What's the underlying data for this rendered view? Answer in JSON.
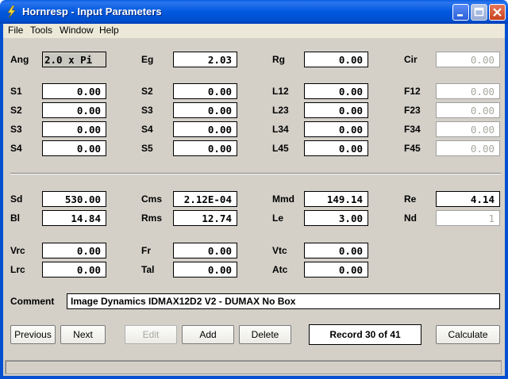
{
  "window": {
    "title": "Hornresp - Input Parameters"
  },
  "menu": [
    "File",
    "Tools",
    "Window",
    "Help"
  ],
  "fields_top": {
    "Ang": {
      "label": "Ang",
      "value": "2.0 x Pi"
    },
    "Eg": {
      "label": "Eg",
      "value": "2.03"
    },
    "Rg": {
      "label": "Rg",
      "value": "0.00"
    },
    "Cir": {
      "label": "Cir",
      "value": "0.00"
    },
    "S1a": {
      "label": "S1",
      "value": "0.00"
    },
    "S2a": {
      "label": "S2",
      "value": "0.00"
    },
    "S3a": {
      "label": "S3",
      "value": "0.00"
    },
    "S4a": {
      "label": "S4",
      "value": "0.00"
    },
    "S2b": {
      "label": "S2",
      "value": "0.00"
    },
    "S3b": {
      "label": "S3",
      "value": "0.00"
    },
    "S4b": {
      "label": "S4",
      "value": "0.00"
    },
    "S5b": {
      "label": "S5",
      "value": "0.00"
    },
    "L12": {
      "label": "L12",
      "value": "0.00"
    },
    "L23": {
      "label": "L23",
      "value": "0.00"
    },
    "L34": {
      "label": "L34",
      "value": "0.00"
    },
    "L45": {
      "label": "L45",
      "value": "0.00"
    },
    "F12": {
      "label": "F12",
      "value": "0.00"
    },
    "F23": {
      "label": "F23",
      "value": "0.00"
    },
    "F34": {
      "label": "F34",
      "value": "0.00"
    },
    "F45": {
      "label": "F45",
      "value": "0.00"
    }
  },
  "fields_driver": {
    "Sd": {
      "label": "Sd",
      "value": "530.00"
    },
    "Bl": {
      "label": "Bl",
      "value": "14.84"
    },
    "Cms": {
      "label": "Cms",
      "value": "2.12E-04"
    },
    "Rms": {
      "label": "Rms",
      "value": "12.74"
    },
    "Mmd": {
      "label": "Mmd",
      "value": "149.14"
    },
    "Le": {
      "label": "Le",
      "value": "3.00"
    },
    "Re": {
      "label": "Re",
      "value": "4.14"
    },
    "Nd": {
      "label": "Nd",
      "value": "1"
    },
    "Vrc": {
      "label": "Vrc",
      "value": "0.00"
    },
    "Lrc": {
      "label": "Lrc",
      "value": "0.00"
    },
    "Fr": {
      "label": "Fr",
      "value": "0.00"
    },
    "Tal": {
      "label": "Tal",
      "value": "0.00"
    },
    "Vtc": {
      "label": "Vtc",
      "value": "0.00"
    },
    "Atc": {
      "label": "Atc",
      "value": "0.00"
    }
  },
  "comment": {
    "label": "Comment",
    "value": "Image Dynamics IDMAX12D2 V2 - DUMAX No Box"
  },
  "buttons": {
    "previous": "Previous",
    "next": "Next",
    "edit": "Edit",
    "add": "Add",
    "delete": "Delete",
    "calculate": "Calculate"
  },
  "record": "Record 30 of 41",
  "colors": {
    "titlebar": "#0058dd",
    "client_bg": "#d4d0c8",
    "disabled_text": "#a8a8a0"
  }
}
